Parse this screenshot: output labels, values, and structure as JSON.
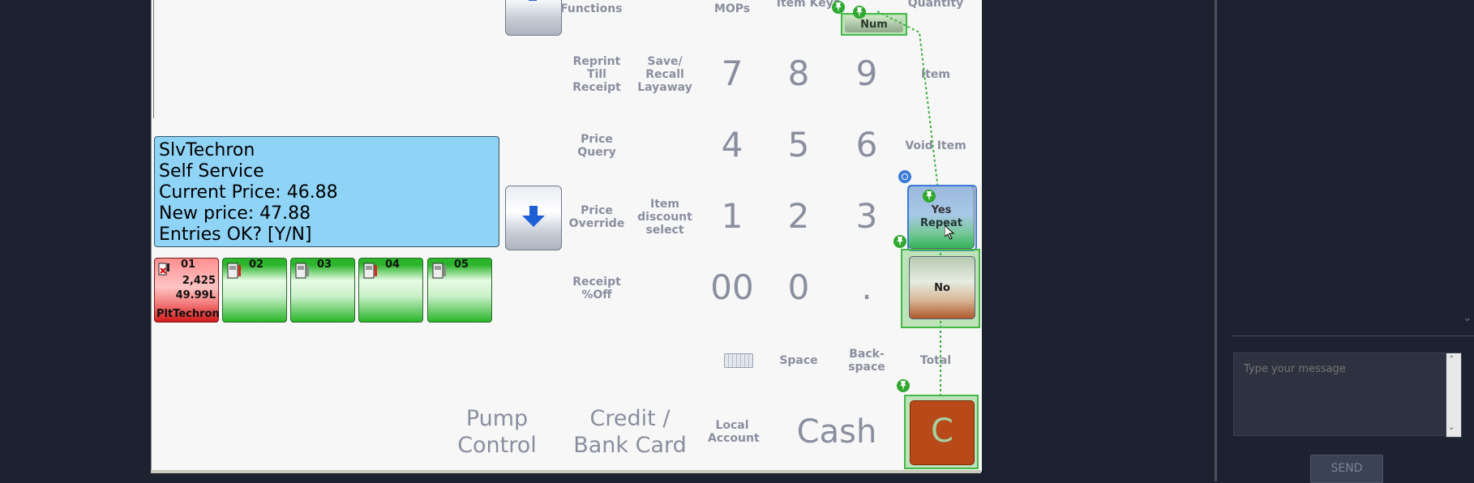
{
  "pos": {
    "keys": {
      "functions": "Functions",
      "mops": "MOPs",
      "item_keys": "Item Keys",
      "quantity": "Quantity",
      "num": "Num",
      "reprint": "Reprint\nTill\nReceipt",
      "save_recall": "Save/\nRecall\nLayaway",
      "item": "Item",
      "price_query": "Price\nQuery",
      "void_item": "Void Item",
      "price_override": "Price\nOverride",
      "item_discount": "Item\ndiscount\nselect",
      "receipt_off": "Receipt\n%Off",
      "space": "Space",
      "backspace": "Back-\nspace",
      "total": "Total",
      "pump_control": "Pump\nControl",
      "credit_bank": "Credit /\nBank Card",
      "local_account": "Local\nAccount",
      "cash": "Cash",
      "yes": "Yes",
      "repeat": "Repeat",
      "no": "No",
      "clear": "C"
    },
    "digits": [
      "7",
      "8",
      "9",
      "4",
      "5",
      "6",
      "1",
      "2",
      "3",
      "00",
      "0",
      "."
    ],
    "info_lines": [
      "SlvTechron",
      "Self Service",
      "Current Price: 46.88",
      "New price: 47.88",
      "Entries OK? [Y/N]"
    ],
    "pumps": [
      {
        "num": "01",
        "volume": "2,425",
        "litres": "49.99L",
        "name": "PltTechron",
        "state": "alert"
      },
      {
        "num": "02",
        "state": "idle"
      },
      {
        "num": "03",
        "state": "idle"
      },
      {
        "num": "04",
        "state": "idle"
      },
      {
        "num": "05",
        "state": "idle"
      }
    ],
    "colors": {
      "info_bg": "#8fd3f6",
      "pump_alert": "#d21a1a",
      "pump_idle": "#2ab52a",
      "clear_btn": "#b84a1a",
      "highlight": "#43b847"
    }
  },
  "chat": {
    "placeholder": "Type your message",
    "send_label": "SEND"
  }
}
